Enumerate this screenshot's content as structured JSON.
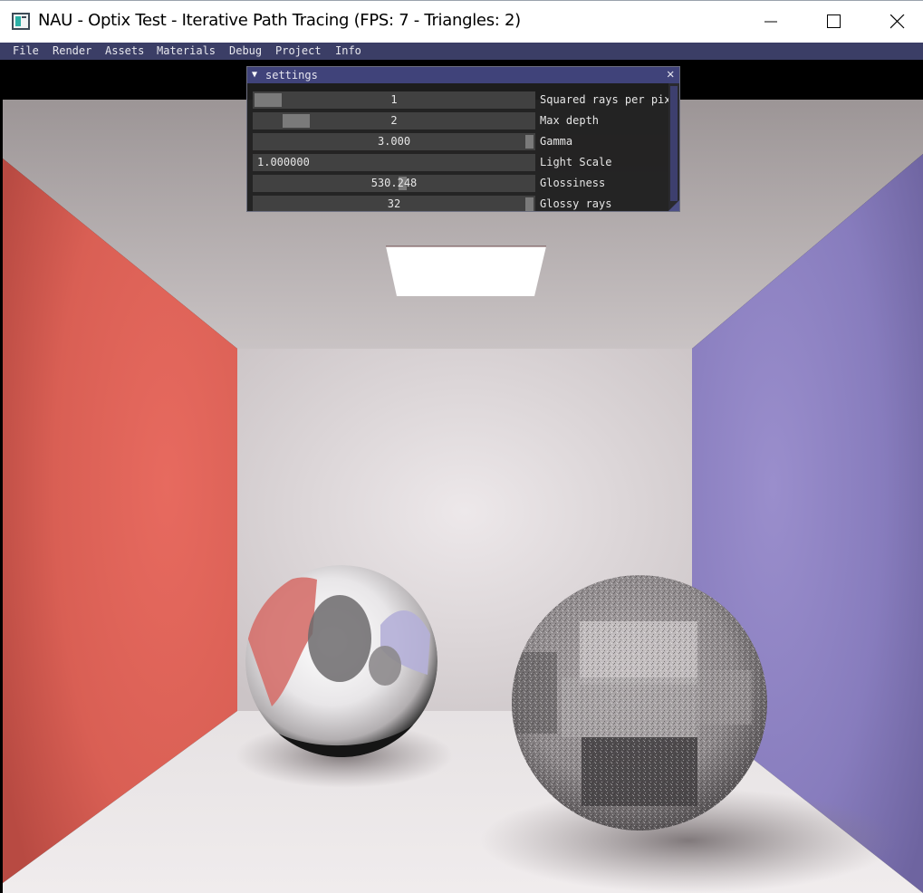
{
  "window": {
    "title": "NAU - Optix Test - Iterative Path Tracing (FPS: 7 - Triangles: 2)",
    "controls": [
      "minimize",
      "maximize",
      "close"
    ]
  },
  "menu": [
    "File",
    "Render",
    "Assets",
    "Materials",
    "Debug",
    "Project",
    "Info"
  ],
  "settings": {
    "title": "settings",
    "collapse_glyph": "▼",
    "close_glyph": "✕",
    "rows": [
      {
        "label": "Squared rays per pix",
        "value": "1",
        "fraction": 0.0
      },
      {
        "label": "Max depth",
        "value": "2",
        "fraction": 0.1
      },
      {
        "label": "Gamma",
        "value": "3.000",
        "fraction": 1.0
      },
      {
        "label": "Light Scale",
        "value": "1.000000"
      },
      {
        "label": "Glossiness",
        "value": "530.248",
        "fraction": 0.53
      },
      {
        "label": "Glossy rays",
        "value": "32",
        "fraction": 1.0
      }
    ]
  },
  "scene": {
    "left_wall_color": "#e06a5f",
    "right_wall_color": "#8a80c4",
    "back_wall_color": "#dcd6d8",
    "ceiling_color": "#b9b3b4",
    "floor_color": "#e4e0e1",
    "light_color": "#ffffff"
  },
  "colors": {
    "menu_bar": "#3b3e66",
    "panel_header": "#40437a",
    "slider_bg": "#414141",
    "slider_grab": "#7a7a7a"
  }
}
